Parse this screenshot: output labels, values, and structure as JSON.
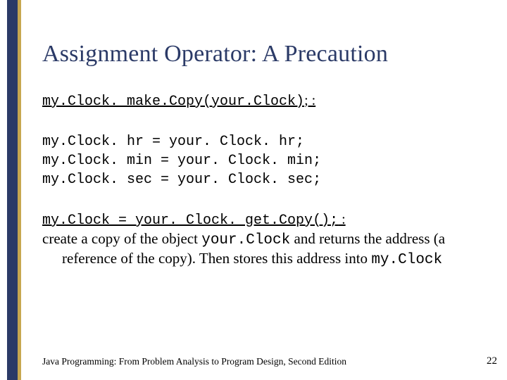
{
  "title": "Assignment Operator: A Precaution",
  "line1_code": "my.Clock. make.Copy(your.Clock)",
  "line1_tail": "; :",
  "code_lines": [
    "my.Clock. hr = your. Clock. hr;",
    "my.Clock. min = your. Clock. min;",
    "my.Clock. sec = your. Clock. sec;"
  ],
  "line2_code": "my.Clock = your. Clock. get.Copy();",
  "line2_tail": " :",
  "explain_pre": "create a copy of the object ",
  "explain_obj1": "your.Clock",
  "explain_mid": " and returns the address (a reference of the copy). Then stores this address into ",
  "explain_obj2": "my.Clock",
  "footer": "Java Programming: From Problem Analysis to Program Design, Second Edition",
  "page_number": "22"
}
